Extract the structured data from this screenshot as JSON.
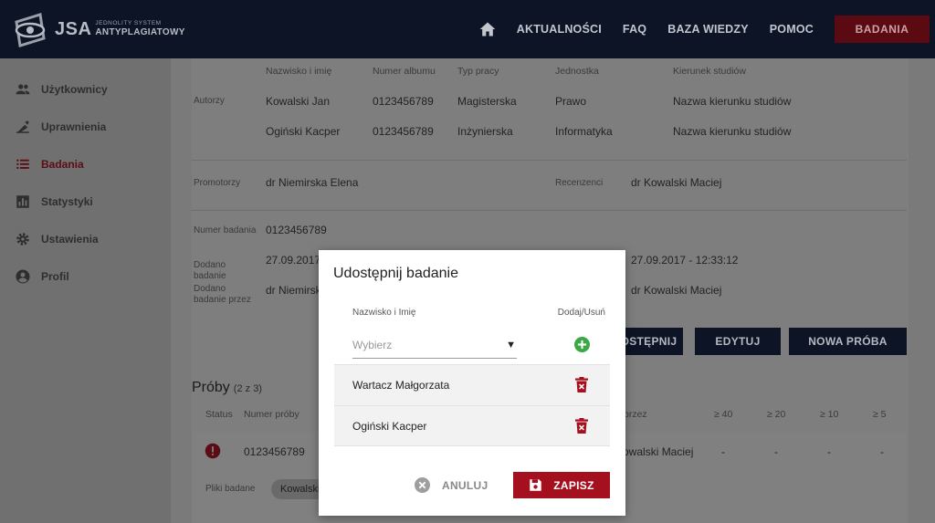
{
  "header": {
    "logo_text": "JSA",
    "logo_sub_1": "JEDNOLITY SYSTEM",
    "logo_sub_2": "ANTYPLAGIATOWY",
    "nav": [
      "AKTUALNOŚCI",
      "FAQ",
      "BAZA WIEDZY",
      "POMOC"
    ],
    "cta": "BADANIA"
  },
  "sidebar": {
    "items": [
      {
        "label": "Użytkownicy",
        "icon": "users-icon"
      },
      {
        "label": "Uprawnienia",
        "icon": "permissions-icon"
      },
      {
        "label": "Badania",
        "icon": "list-icon",
        "active": true
      },
      {
        "label": "Statystyki",
        "icon": "chart-icon"
      },
      {
        "label": "Ustawienia",
        "icon": "gear-icon"
      },
      {
        "label": "Profil",
        "icon": "account-icon"
      }
    ]
  },
  "details": {
    "authors_label": "Autorzy",
    "cols": [
      "Nazwisko i imię",
      "Numer albumu",
      "Typ pracy",
      "Jednostka",
      "Kierunek studiów"
    ],
    "authors": [
      [
        "Kowalski Jan",
        "0123456789",
        "Magisterska",
        "Prawo",
        "Nazwa kierunku studiów"
      ],
      [
        "Ogiński Kacper",
        "0123456789",
        "Inżynierska",
        "Informatyka",
        "Nazwa kierunku studiów"
      ]
    ],
    "promotors_label": "Promotorzy",
    "promotor": "dr Niemirska Elena",
    "reviews_label": "Recenzenci",
    "reviewer": "dr Kowalski Maciej",
    "study_number_label": "Numer badania",
    "study_number": "0123456789",
    "added_label": "Dodano badanie",
    "added_date": "27.09.2017",
    "added_by_label": "Dodano badanie przez",
    "added_by": "dr Niemirska Elena",
    "right_date": "27.09.2017 - 12:33:12",
    "right_person": "dr Kowalski Maciej"
  },
  "actions": {
    "share": "UDOSTĘPNIJ",
    "edit": "EDYTUJ",
    "new_try": "NOWA PRÓBA"
  },
  "tries": {
    "title": "Próby",
    "count": "(2 z 3)",
    "cols": [
      "Status",
      "Numer próby",
      "przez",
      "≥ 40",
      "≥ 20",
      "≥ 10",
      "≥ 5"
    ],
    "row": {
      "number": "0123456789",
      "by": "dr Kowalski Maciej",
      "vals": [
        "-",
        "-",
        "-",
        "-"
      ]
    },
    "files_label": "Pliki badane",
    "file_pill": "Kowalski"
  },
  "modal": {
    "title": "Udostępnij badanie",
    "col_name": "Nazwisko i Imię",
    "col_action": "Dodaj/Usuń",
    "select_placeholder": "Wybierz",
    "people": [
      "Wartacz Małgorzata",
      "Ogiński Kacper"
    ],
    "cancel": "ANULUJ",
    "save": "ZAPISZ"
  },
  "colors": {
    "topbar": "#0c1425",
    "accent": "#a5101e",
    "add_green": "#3aa845",
    "overlay": "#7a7a7a"
  }
}
